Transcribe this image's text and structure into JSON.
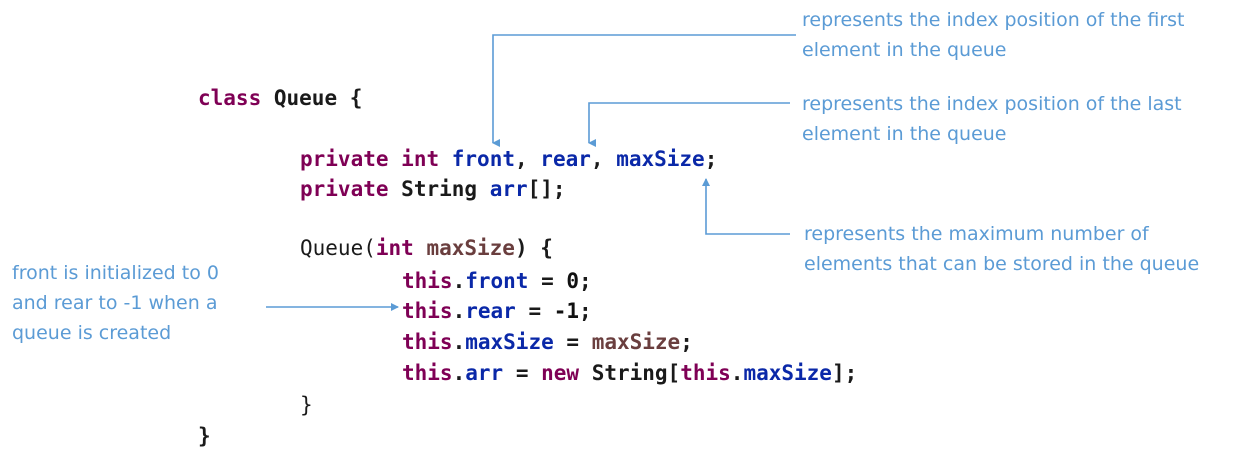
{
  "code": {
    "line1": {
      "class_kw": "class",
      "name": "Queue",
      "brace": "{"
    },
    "line2": {
      "private_kw": "private",
      "int_kw": "int",
      "front": "front",
      "c1": ",",
      "rear": "rear",
      "c2": ",",
      "maxSize": "maxSize",
      "semi": ";"
    },
    "line3": {
      "private_kw": "private",
      "type": "String",
      "arr": "arr",
      "tail": "[];"
    },
    "line4": {
      "ctor": "Queue(",
      "int_kw": "int",
      "param": "maxSize",
      "tail": ") {"
    },
    "line5": {
      "this": "this",
      "dot": ".",
      "field": "front",
      "eq": " = ",
      "val": "0",
      "semi": ";"
    },
    "line6": {
      "this": "this",
      "dot": ".",
      "field": "rear",
      "eq": " = ",
      "val": "-1",
      "semi": ";"
    },
    "line7": {
      "this": "this",
      "dot": ".",
      "field": "maxSize",
      "eq": " = ",
      "val": "maxSize",
      "semi": ";"
    },
    "line8": {
      "this": "this",
      "dot": ".",
      "field": "arr",
      "eq": " = ",
      "new_kw": "new",
      "type": "String[",
      "this2": "this",
      "dot2": ".",
      "field2": "maxSize",
      "tail": "];"
    },
    "line9": {
      "brace": "}"
    },
    "line10": {
      "brace": "}"
    }
  },
  "annotations": {
    "front": [
      "represents the index position of the first",
      "element in the queue"
    ],
    "rear": [
      "represents the index position of the last",
      "element in the queue"
    ],
    "maxSize": [
      "represents the maximum number of",
      "elements that can be stored in the queue"
    ],
    "constructor": [
      "front is initialized to 0",
      "and rear to -1 when a",
      "queue is created"
    ]
  },
  "colors": {
    "annotation": "#5b9bd5",
    "keyword": "#7f0055",
    "field": "#0a28a8",
    "variable": "#6a3e3e"
  }
}
